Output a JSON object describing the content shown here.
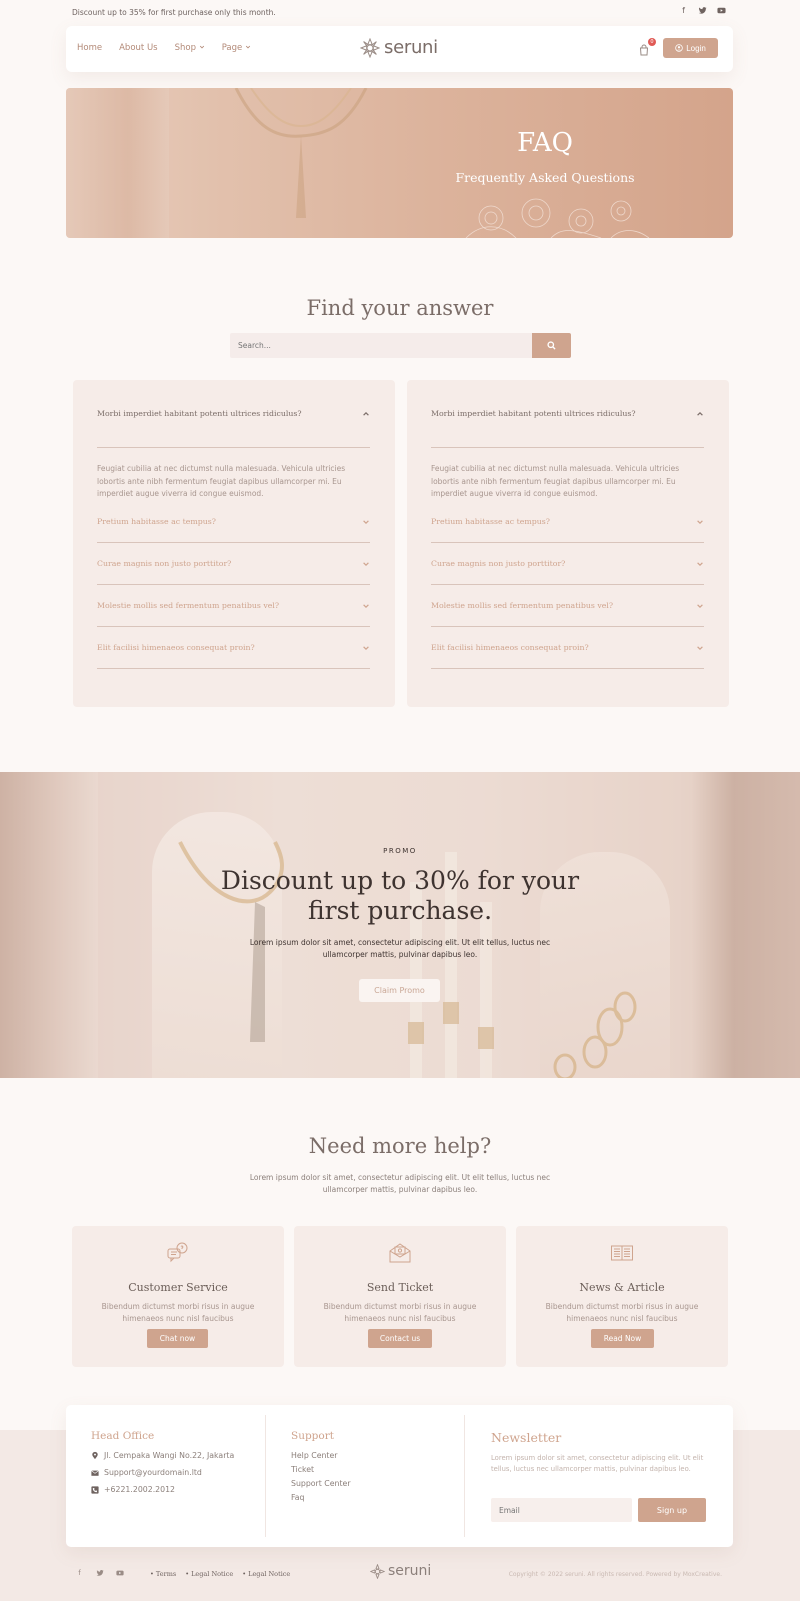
{
  "topbar": {
    "notice": "Discount up to 35% for first purchase only this month.",
    "socials": [
      "facebook-icon",
      "twitter-icon",
      "youtube-icon"
    ]
  },
  "nav": {
    "items": [
      {
        "label": "Home"
      },
      {
        "label": "About Us"
      },
      {
        "label": "Shop",
        "dropdown": true
      },
      {
        "label": "Page",
        "dropdown": true
      }
    ],
    "logo_text": "seruni",
    "cart_count": "0",
    "login_label": "Login"
  },
  "hero": {
    "title": "FAQ",
    "subtitle": "Frequently Asked Questions"
  },
  "find": {
    "title": "Find your answer",
    "search_placeholder": "Search..."
  },
  "faq": {
    "columns": [
      {
        "open_question": "Morbi imperdiet habitant potenti ultrices ridiculus?",
        "open_answer": "Feugiat cubilia at nec dictumst nulla malesuada. Vehicula ultricies lobortis ante nibh fermentum feugiat dapibus ullamcorper mi. Eu imperdiet augue viverra id congue euismod.",
        "questions": [
          "Pretium habitasse ac tempus?",
          "Curae magnis non justo porttitor?",
          "Molestie mollis sed fermentum penatibus vel?",
          "Elit facilisi himenaeos consequat proin?"
        ]
      },
      {
        "open_question": "Morbi imperdiet habitant potenti ultrices ridiculus?",
        "open_answer": "Feugiat cubilia at nec dictumst nulla malesuada. Vehicula ultricies lobortis ante nibh fermentum feugiat dapibus ullamcorper mi. Eu imperdiet augue viverra id congue euismod.",
        "questions": [
          "Pretium habitasse ac tempus?",
          "Curae magnis non justo porttitor?",
          "Molestie mollis sed fermentum penatibus vel?",
          "Elit facilisi himenaeos consequat proin?"
        ]
      }
    ]
  },
  "promo": {
    "tag": "PROMO",
    "title": "Discount up to 30% for your first purchase.",
    "text": "Lorem ipsum dolor sit amet, consectetur adipiscing elit. Ut elit tellus, luctus nec ullamcorper mattis, pulvinar dapibus leo.",
    "button": "Claim Promo"
  },
  "help": {
    "title": "Need more help?",
    "text": "Lorem ipsum dolor sit amet, consectetur adipiscing elit. Ut elit tellus, luctus nec ullamcorper mattis, pulvinar dapibus leo.",
    "cards": [
      {
        "icon": "chat-bubbles-icon",
        "title": "Customer Service",
        "desc": "Bibendum dictumst morbi risus in augue himenaeos nunc nisl faucibus",
        "button": "Chat now"
      },
      {
        "icon": "envelope-icon",
        "title": "Send Ticket",
        "desc": "Bibendum dictumst morbi risus in augue himenaeos nunc nisl faucibus",
        "button": "Contact us"
      },
      {
        "icon": "book-icon",
        "title": "News & Article",
        "desc": "Bibendum dictumst morbi risus in augue himenaeos nunc nisl faucibus",
        "button": "Read Now"
      }
    ]
  },
  "footer": {
    "head_office": {
      "title": "Head Office",
      "address": "Jl. Cempaka Wangi No.22, Jakarta",
      "email": "Support@yourdomain.ltd",
      "phone": "+6221.2002.2012"
    },
    "support": {
      "title": "Support",
      "links": [
        "Help Center",
        "Ticket",
        "Support Center",
        "Faq"
      ]
    },
    "newsletter": {
      "title": "Newsletter",
      "text": "Lorem ipsum dolor sit amet, consectetur adipiscing elit. Ut elit tellus, luctus nec ullamcorper mattis, pulvinar dapibus leo.",
      "email_placeholder": "Email",
      "button": "Sign up"
    }
  },
  "bottombar": {
    "links": [
      "Terms",
      "Legal Notice",
      "Legal Notice"
    ],
    "logo_text": "seruni",
    "copyright": "Copyright © 2022 seruni. All rights reserved. Powered by MoxCreative."
  },
  "colors": {
    "accent": "#cfa48e",
    "background": "#fcf8f6",
    "card": "#f6ece8",
    "text_dark": "#3e3330"
  }
}
